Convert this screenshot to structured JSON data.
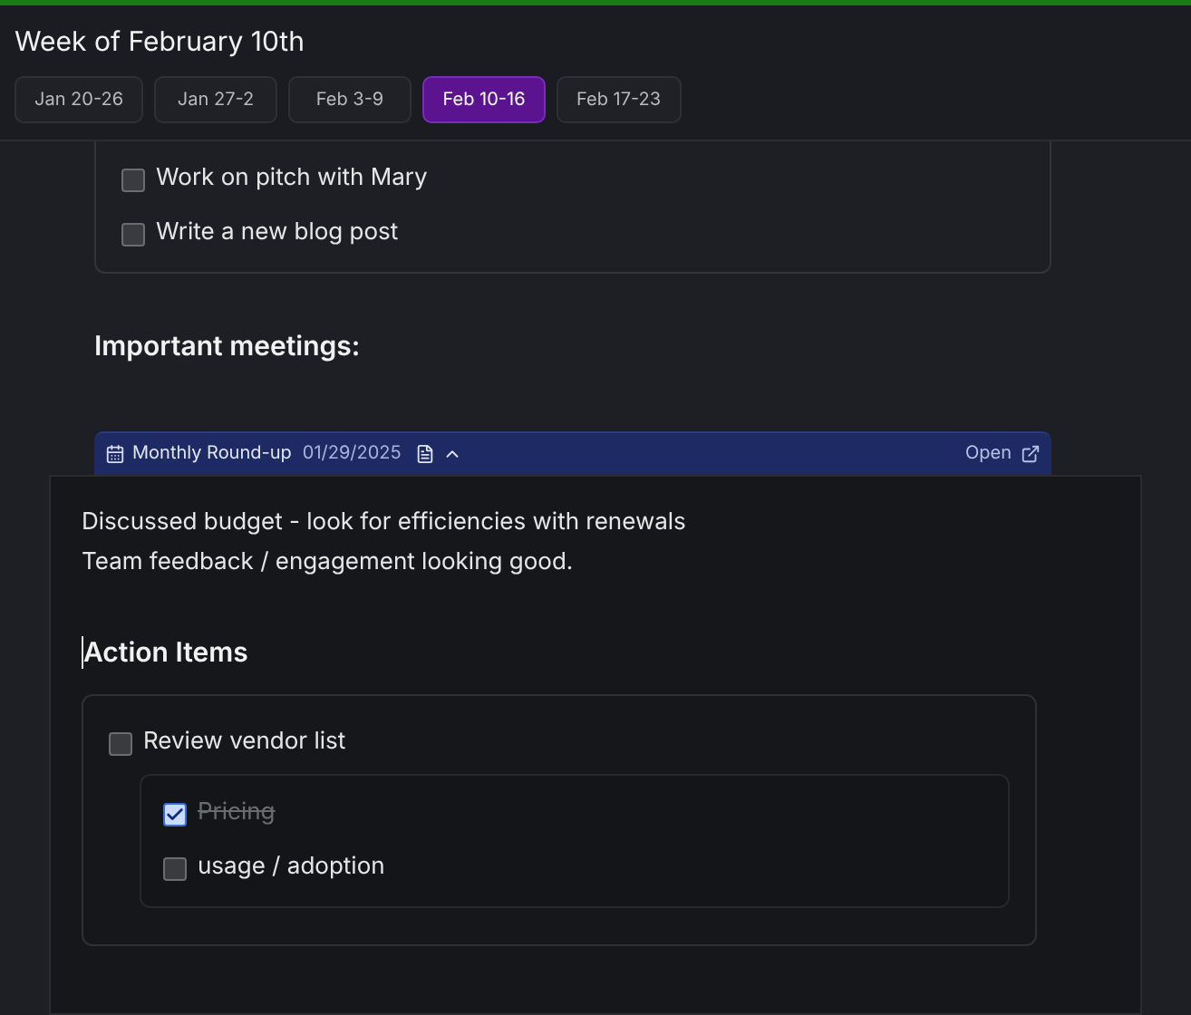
{
  "header": {
    "title": "Week of February 10th"
  },
  "tabs": [
    {
      "label": "Jan 20-26",
      "selected": false
    },
    {
      "label": "Jan 27-2",
      "selected": false
    },
    {
      "label": "Feb 3-9",
      "selected": false
    },
    {
      "label": "Feb 10-16",
      "selected": true
    },
    {
      "label": "Feb 17-23",
      "selected": false
    }
  ],
  "tasks": [
    {
      "label": "Work on pitch with Mary",
      "checked": false
    },
    {
      "label": "Write a new blog post",
      "checked": false
    }
  ],
  "meetings_heading": "Important meetings:",
  "meeting": {
    "title": "Monthly Round-up",
    "date": "01/29/2025",
    "expanded": true,
    "open_label": "Open"
  },
  "notes": [
    "Discussed budget - look for efficiencies with renewals",
    "Team feedback / engagement looking good."
  ],
  "action_items_heading": "Action Items",
  "action_items": [
    {
      "label": "Review vendor list",
      "checked": false,
      "children": [
        {
          "label": "Pricing",
          "checked": true
        },
        {
          "label": "usage / adoption",
          "checked": false
        }
      ]
    }
  ]
}
